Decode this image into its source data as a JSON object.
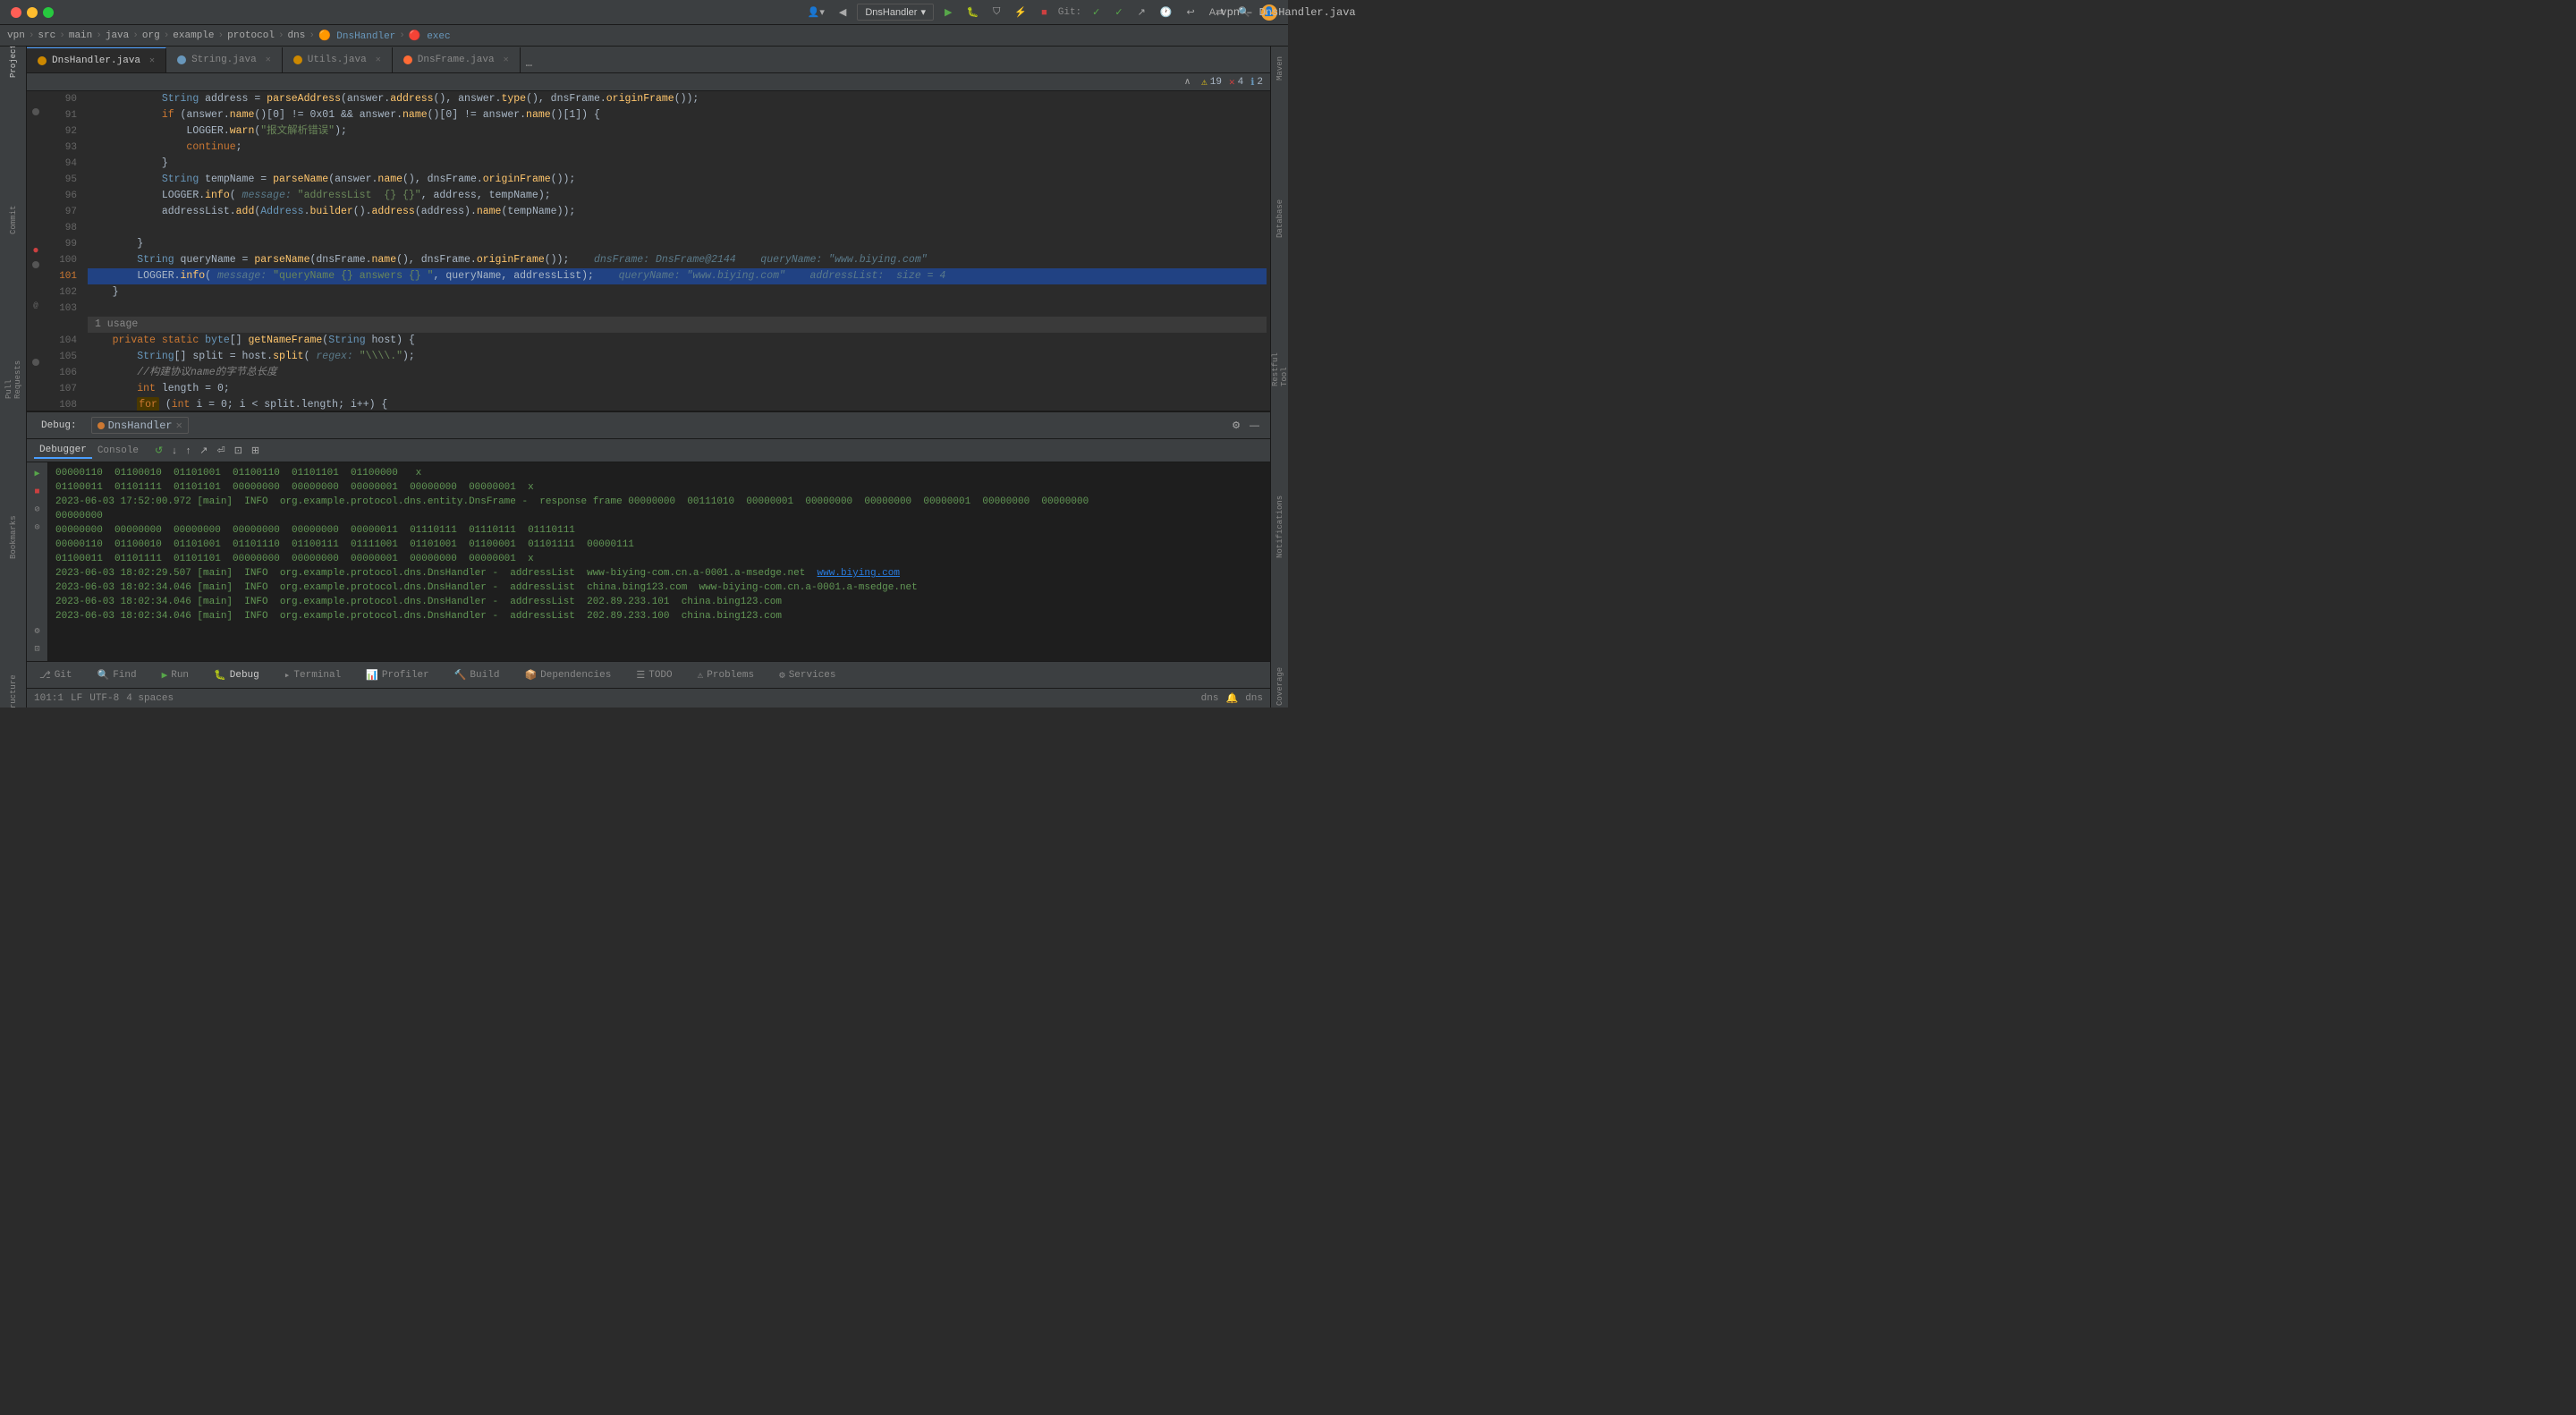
{
  "titlebar": {
    "title": "vpn – DnsHandler.java",
    "controls": [
      "close",
      "minimize",
      "maximize"
    ]
  },
  "breadcrumb": {
    "items": [
      "vpn",
      "src",
      "main",
      "java",
      "org",
      "example",
      "protocol",
      "dns",
      "DnsHandler",
      "exec"
    ]
  },
  "tabs": [
    {
      "label": "DnsHandler.java",
      "type": "java",
      "active": true
    },
    {
      "label": "String.java",
      "type": "java",
      "active": false
    },
    {
      "label": "Utils.java",
      "type": "java",
      "active": false
    },
    {
      "label": "DnsFrame.java",
      "type": "java",
      "active": false
    }
  ],
  "warnings": {
    "warn_count": "19",
    "error_count": "4",
    "info_count": "2"
  },
  "code_lines": [
    {
      "num": "90",
      "content": "            String address = parseAddress(answer.address(), answer.type(), dnsFrame.originFrame());"
    },
    {
      "num": "91",
      "content": "            if (answer.name()[0] != 0x01 && answer.name()[0] != answer.name()[1]) {"
    },
    {
      "num": "92",
      "content": "                LOGGER.warn(\"报文解析错误\");"
    },
    {
      "num": "93",
      "content": "                continue;"
    },
    {
      "num": "94",
      "content": "            }"
    },
    {
      "num": "95",
      "content": "            String tempName = parseName(answer.name(), dnsFrame.originFrame());"
    },
    {
      "num": "96",
      "content": "            LOGGER.info( message: \"addressList  {} {}\", address, tempName);"
    },
    {
      "num": "97",
      "content": "            addressList.add(Address.builder().address(address).name(tempName));"
    },
    {
      "num": "98",
      "content": ""
    },
    {
      "num": "99",
      "content": "        }"
    },
    {
      "num": "100",
      "content": "        String queryName = parseName(dnsFrame.name(), dnsFrame.originFrame());    dnsFrame: DnsFrame@2144    queryName: \"www.biying.com\""
    },
    {
      "num": "101",
      "content": "        LOGGER.info( message: \"queryName {} answers {} \", queryName, addressList);    queryName: \"www.biying.com\"    addressList:  size = 4"
    },
    {
      "num": "102",
      "content": "    }"
    },
    {
      "num": "103",
      "content": ""
    },
    {
      "num": "",
      "content": "    1 usage"
    },
    {
      "num": "104",
      "content": "    private static byte[] getNameFrame(String host) {"
    },
    {
      "num": "105",
      "content": "        String[] split = host.split( regex: \"\\\\.\");"
    },
    {
      "num": "106",
      "content": "        //构建协议name的字节总长度"
    },
    {
      "num": "107",
      "content": "        int length = 0;"
    },
    {
      "num": "108",
      "content": "        for (int i = 0; i < split.length; i++) {"
    },
    {
      "num": "109",
      "content": "            //存储字节"
    },
    {
      "num": "110",
      "content": "            length++;"
    },
    {
      "num": "111",
      "content": "            length += split[i].length();"
    }
  ],
  "debug": {
    "label": "Debug:",
    "session": "DnsHandler",
    "tabs": [
      "Debugger",
      "Console"
    ],
    "active_tab": "Debugger"
  },
  "console_lines": [
    {
      "text": "00000110  01100010  01101001  01100110  01101101  01100000   x",
      "class": "log-green"
    },
    {
      "text": "01100011  01101111  01101101  00000000  00000000  00000001  00000000  00000001  x",
      "class": "log-green"
    },
    {
      "text": "2023-06-03 17:52:00.972 [main]  INFO  org.example.protocol.dns.entity.DnsFrame -  response frame 00000000  00111010  00000001  00000000  00000000  00000001  00000000",
      "class": "log-green"
    },
    {
      "text": "00000000",
      "class": "log-green"
    },
    {
      "text": "00000000  00000000  00000000  00000000  00000000  00000011  01110111  01110111  01110111",
      "class": "log-green"
    },
    {
      "text": "00000110  01100010  01101001  01100111  01111001  01101001  01100001  01101111  00000111",
      "class": "log-green"
    },
    {
      "text": "01100011  01101111  01101101  00000000  00000000  00000001  00000000  00000001  x",
      "class": "log-green"
    },
    {
      "text": "2023-06-03 18:02:29.507 [main]  INFO  org.example.protocol.dns.DnsHandler -  addressList  www-biying-com.cn.a-0001.a-msedge.net  www.biying.com",
      "class": "log-green",
      "link": "www.biying.com"
    },
    {
      "text": "2023-06-03 18:02:34.046 [main]  INFO  org.example.protocol.dns.DnsHandler -  addressList  china.bing123.com  www-biying-com.cn.a-0001.a-msedge.net",
      "class": "log-green"
    },
    {
      "text": "2023-06-03 18:02:34.046 [main]  INFO  org.example.protocol.dns.DnsHandler -  addressList  202.89.233.101  china.bing123.com",
      "class": "log-green"
    },
    {
      "text": "2023-06-03 18:02:34.046 [main]  INFO  org.example.protocol.dns.DnsHandler -  addressList  202.89.233.100  china.bing123.com",
      "class": "log-green"
    }
  ],
  "bottom_tools": [
    {
      "label": "Git",
      "icon": "⎇"
    },
    {
      "label": "Find",
      "icon": "🔍"
    },
    {
      "label": "Run",
      "icon": "▶"
    },
    {
      "label": "Debug",
      "icon": "🐛",
      "active": true
    },
    {
      "label": "Terminal",
      "icon": ">"
    },
    {
      "label": "Profiler",
      "icon": "📊"
    },
    {
      "label": "Build",
      "icon": "🔨"
    },
    {
      "label": "Dependencies",
      "icon": "📦"
    },
    {
      "label": "TODO",
      "icon": "☑"
    },
    {
      "label": "Problems",
      "icon": "⚠"
    },
    {
      "label": "Services",
      "icon": "⚙"
    }
  ],
  "status_bar": {
    "position": "101:1",
    "line_ending": "LF",
    "encoding": "UTF-8",
    "indent": "4 spaces",
    "dns_label": "dns",
    "git_branch": "dns"
  }
}
